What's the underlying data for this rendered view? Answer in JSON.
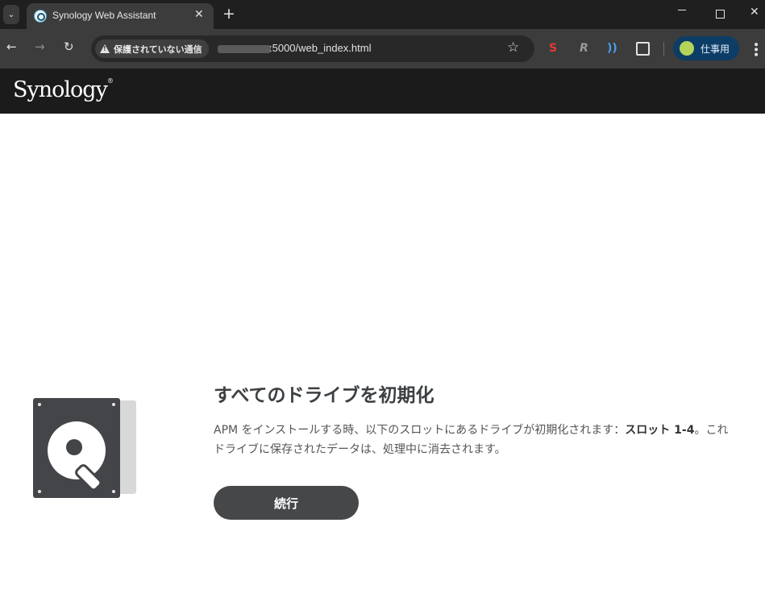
{
  "browser": {
    "tab": {
      "title": "Synology Web Assistant",
      "close_glyph": "✕"
    },
    "tab_search_glyph": "⌄",
    "new_tab_glyph": "+",
    "window": {
      "close_glyph": "✕"
    },
    "nav": {
      "back_glyph": "←",
      "forward_glyph": "→",
      "reload_glyph": "↻"
    },
    "security_chip": "保護されていない通信",
    "url": ":5000/web_index.html",
    "star_glyph": "☆",
    "extensions": [
      {
        "name": "red-s-extension-icon",
        "glyph": "S"
      },
      {
        "name": "r-extension-icon",
        "glyph": "R"
      },
      {
        "name": "wifi-extension-icon",
        "glyph": "))"
      }
    ],
    "profile": {
      "label": "仕事用"
    },
    "menu_glyph": "•••"
  },
  "app": {
    "logo": "Synology",
    "logo_mark": "®"
  },
  "main": {
    "title": "すべてのドライブを初期化",
    "desc_part1": "APM をインストールする時、以下のスロットにあるドライブが初期化されます：",
    "desc_bold": "スロット 1-4",
    "desc_part2": "。これ",
    "desc_line2": "ドライブに保存されたデータは、処理中に消去されます。",
    "continue_label": "続行"
  },
  "colors": {
    "header_bg": "#1b1b1c",
    "button_bg": "#454749",
    "profile_bg": "#0c3d66",
    "drive_bg": "#434548"
  }
}
